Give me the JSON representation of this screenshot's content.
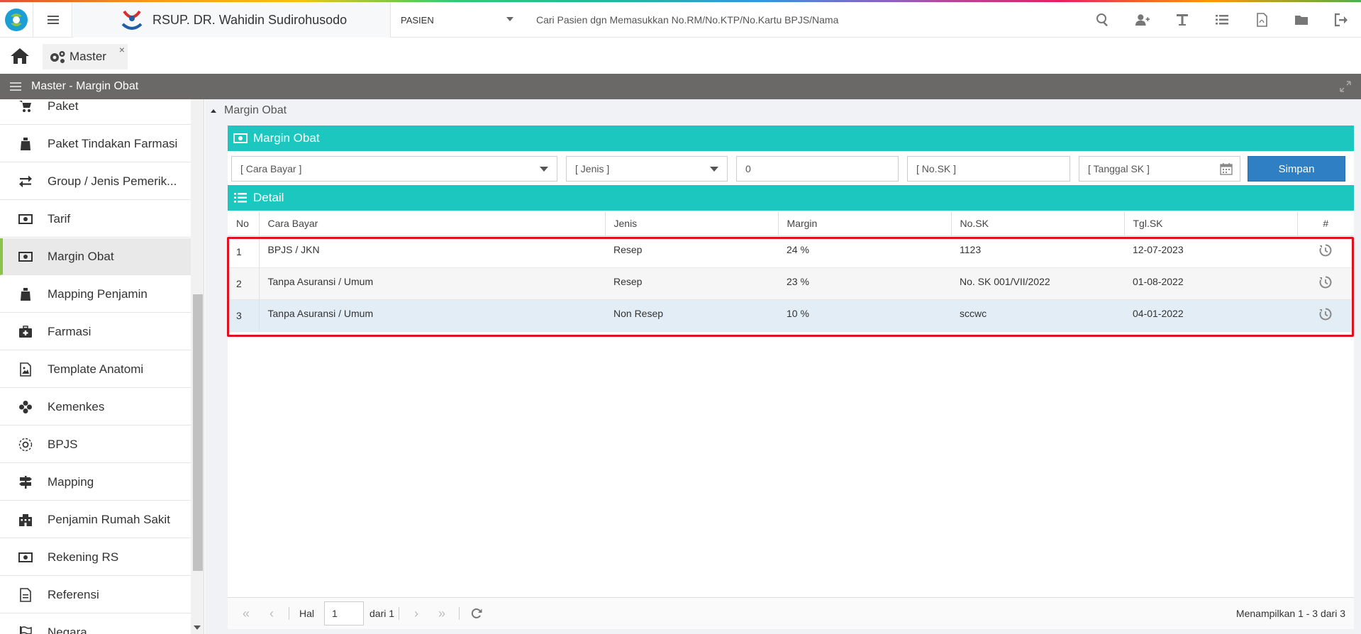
{
  "topbar": {
    "hospital_name": "RSUP. DR. Wahidin Sudirohusodo",
    "search_category": "PASIEN",
    "search_placeholder": "Cari Pasien dgn Memasukkan No.RM/No.KTP/No.Kartu BPJS/Nama",
    "icons": [
      "search-icon",
      "add-user-icon",
      "text-icon",
      "list-icon",
      "pdf-icon",
      "folder-icon",
      "logout-icon"
    ]
  },
  "tabs": {
    "master_label": "Master",
    "close_label": "×"
  },
  "panel": {
    "title": "Master - Margin Obat"
  },
  "sidebar": {
    "items": [
      {
        "label": "Paket",
        "icon": "cart-icon"
      },
      {
        "label": "Paket Tindakan Farmasi",
        "icon": "bag-icon"
      },
      {
        "label": "Group / Jenis Pemerik...",
        "icon": "exchange-icon"
      },
      {
        "label": "Tarif",
        "icon": "money-icon"
      },
      {
        "label": "Margin Obat",
        "icon": "money-icon"
      },
      {
        "label": "Mapping Penjamin",
        "icon": "bag-icon"
      },
      {
        "label": "Farmasi",
        "icon": "medkit-icon"
      },
      {
        "label": "Template Anatomi",
        "icon": "image-file-icon"
      },
      {
        "label": "Kemenkes",
        "icon": "pinwheel-icon"
      },
      {
        "label": "BPJS",
        "icon": "gear-circle-icon"
      },
      {
        "label": "Mapping",
        "icon": "signpost-icon"
      },
      {
        "label": "Penjamin Rumah Sakit",
        "icon": "building-icon"
      },
      {
        "label": "Rekening RS",
        "icon": "money-icon"
      },
      {
        "label": "Referensi",
        "icon": "file-icon"
      },
      {
        "label": "Negara",
        "icon": "flag-icon"
      }
    ],
    "active_index": 4
  },
  "content": {
    "breadcrumb": "Margin Obat",
    "form_title": "Margin Obat",
    "form": {
      "cara_bayar_placeholder": "[ Cara Bayar ]",
      "jenis_placeholder": "[ Jenis ]",
      "margin_value": "0",
      "no_sk_placeholder": "[ No.SK ]",
      "tanggal_sk_placeholder": "[ Tanggal SK ]",
      "save_label": "Simpan"
    },
    "detail_title": "Detail",
    "table": {
      "headers": [
        "No",
        "Cara Bayar",
        "Jenis",
        "Margin",
        "No.SK",
        "Tgl.SK",
        "#"
      ],
      "rows": [
        {
          "no": "1",
          "cara_bayar": "BPJS / JKN",
          "jenis": "Resep",
          "margin": "24 %",
          "no_sk": "1123",
          "tgl_sk": "12-07-2023"
        },
        {
          "no": "2",
          "cara_bayar": "Tanpa Asuransi / Umum",
          "jenis": "Resep",
          "margin": "23 %",
          "no_sk": "No. SK 001/VII/2022",
          "tgl_sk": "01-08-2022"
        },
        {
          "no": "3",
          "cara_bayar": "Tanpa Asuransi / Umum",
          "jenis": "Non Resep",
          "margin": "10 %",
          "no_sk": "sccwc",
          "tgl_sk": "04-01-2022"
        }
      ]
    },
    "pager": {
      "hal_label": "Hal",
      "page": "1",
      "of_label": "dari 1",
      "info": "Menampilkan 1 - 3 dari 3"
    }
  },
  "colors": {
    "teal_header": "#1cc7bf",
    "save_button": "#2f7fc4",
    "panel_bar": "#6b6868",
    "highlight_border": "#e0101f",
    "active_marker": "#8bc34a"
  }
}
